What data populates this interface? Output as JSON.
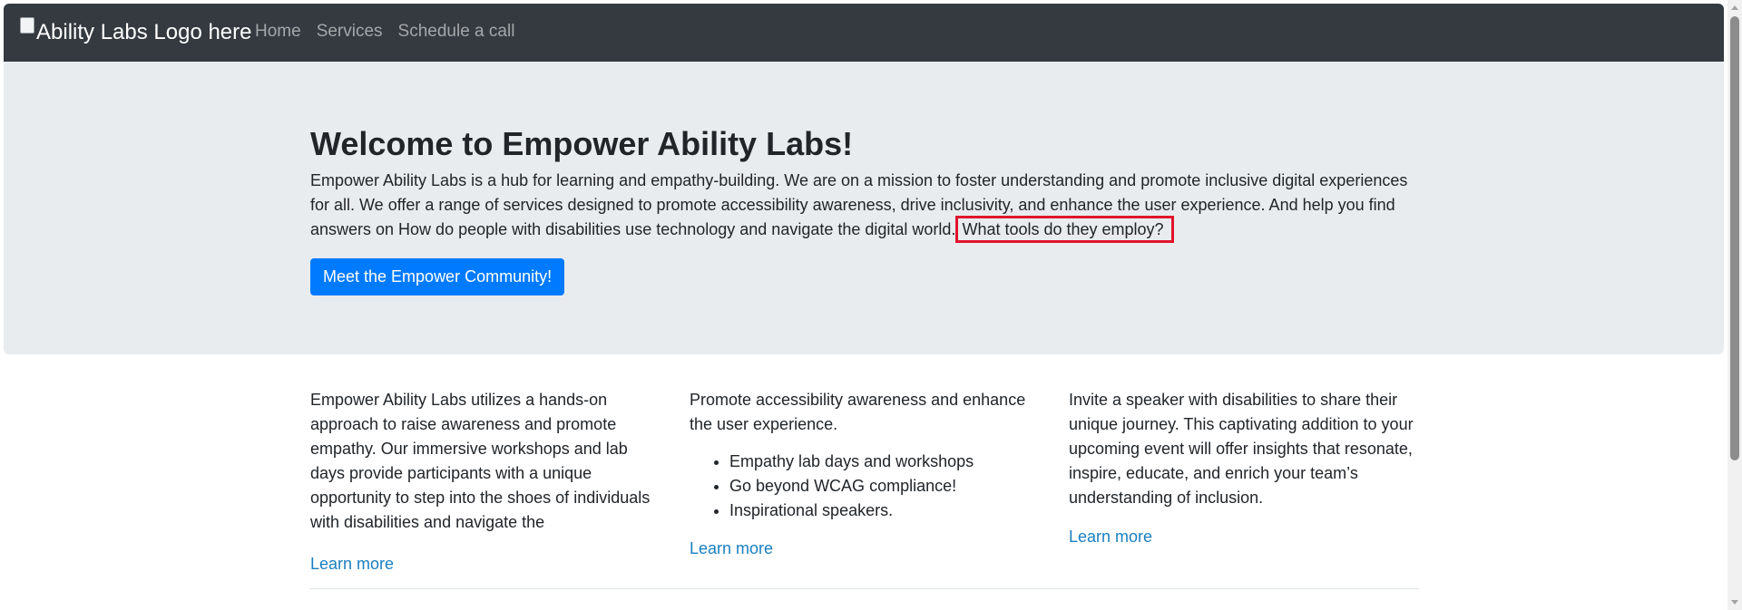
{
  "navbar": {
    "brand_alt_text": "Ability Labs Logo here",
    "links": [
      {
        "label": "Home"
      },
      {
        "label": "Services"
      },
      {
        "label": "Schedule a call"
      }
    ]
  },
  "hero": {
    "title": "Welcome to Empower Ability Labs!",
    "text_main": "Empower Ability Labs is a hub for learning and empathy-building. We are on a mission to foster understanding and promote inclusive digital experiences for all. We offer a range of services designed to promote accessibility awareness, drive inclusivity, and enhance the user experience. And help you find answers on How do people with disabilities use technology and navigate the digital world.",
    "text_highlight": "What tools do they employ?",
    "button_label": "Meet the Empower Community!",
    "highlight_color": "#e0142b"
  },
  "columns": [
    {
      "text": "Empower Ability Labs utilizes a hands-on approach to raise awareness and promote empathy. Our immersive workshops and lab days provide participants with a unique opportunity to step into the shoes of individuals with disabilities and navigate the",
      "link_label": "Learn more"
    },
    {
      "text": "Promote accessibility awareness and enhance the user experience.",
      "list": [
        "Empathy lab days and workshops",
        "Go beyond WCAG compliance!",
        "Inspirational speakers."
      ],
      "link_label": "Learn more"
    },
    {
      "text": "Invite a speaker with disabilities to share their unique journey. This captivating addition to your upcoming event will offer insights that resonate, inspire, educate, and enrich your team’s understanding of inclusion.",
      "link_label": "Learn more"
    }
  ],
  "colors": {
    "navbar_bg": "#343a40",
    "hero_bg": "#e9ecef",
    "primary_button": "#007bff",
    "link": "#1a7fc1"
  }
}
